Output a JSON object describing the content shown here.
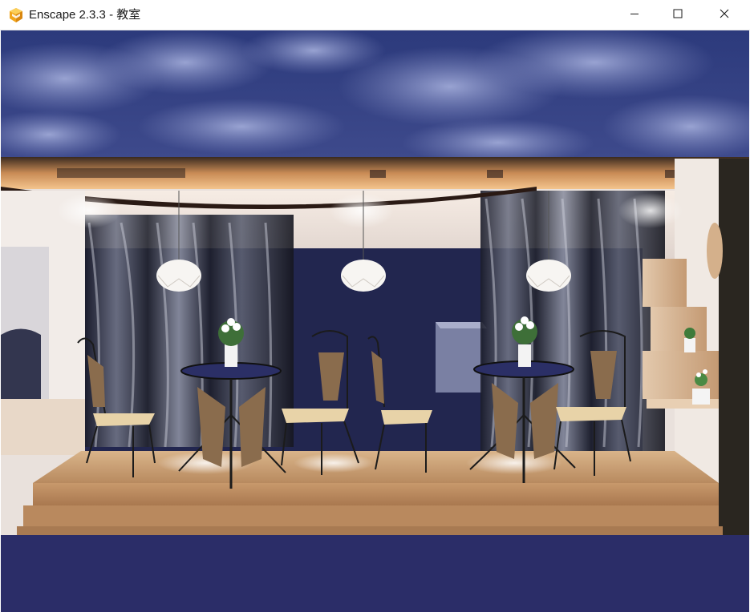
{
  "window": {
    "title": "Enscape 2.3.3 - 教室",
    "icon": "enscape-logo-icon",
    "controls": {
      "minimize": "minimize-icon",
      "maximize": "maximize-icon",
      "close": "close-icon"
    }
  },
  "viewport": {
    "scene": "rendered café stage with round tables, wicker chairs, pendant lamps, flower vases and wall shelves",
    "colors": {
      "sky": "#2b3a7a",
      "floor_wood": "#c9a27a",
      "backdrop": "#1f2350",
      "ground": "#2b2d66"
    }
  }
}
